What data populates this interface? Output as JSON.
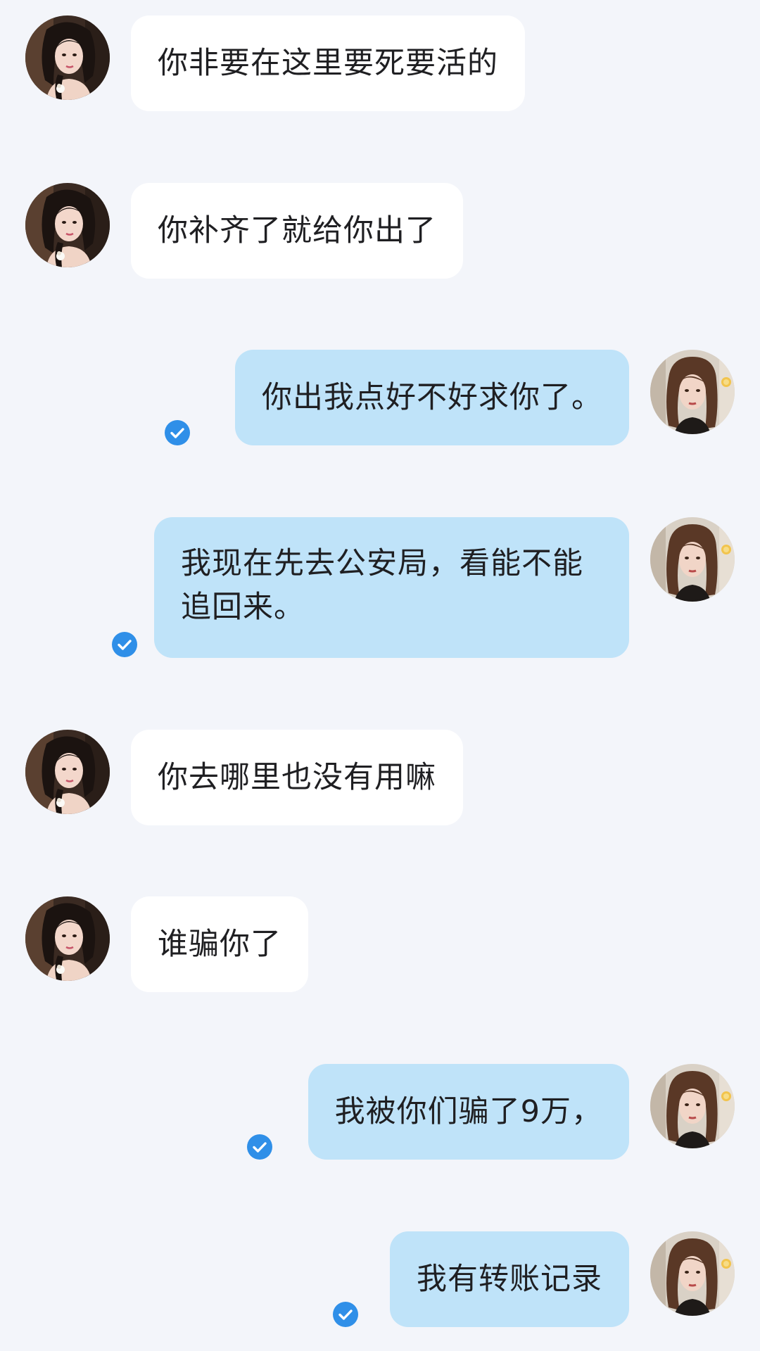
{
  "conversation": {
    "messages": [
      {
        "sender": "contact",
        "text": "你非要在这里要死要活的"
      },
      {
        "sender": "contact",
        "text": "你补齐了就给你出了"
      },
      {
        "sender": "me",
        "text": "你出我点好不好求你了。",
        "read": true
      },
      {
        "sender": "me",
        "text": "我现在先去公安局，看能不能追回来。",
        "read": true
      },
      {
        "sender": "contact",
        "text": "你去哪里也没有用嘛"
      },
      {
        "sender": "contact",
        "text": "谁骗你了"
      },
      {
        "sender": "me",
        "text": "我被你们骗了9万，",
        "read": true
      },
      {
        "sender": "me",
        "text": "我有转账记录",
        "read": true
      }
    ]
  },
  "colors": {
    "background": "#f3f5fa",
    "incoming_bubble": "#ffffff",
    "outgoing_bubble": "#bfe3f9",
    "read_indicator": "#2f8fe8"
  },
  "icons": {
    "read_receipt": "check-circle-icon",
    "contact_avatar": "contact-avatar",
    "my_avatar": "user-avatar"
  }
}
